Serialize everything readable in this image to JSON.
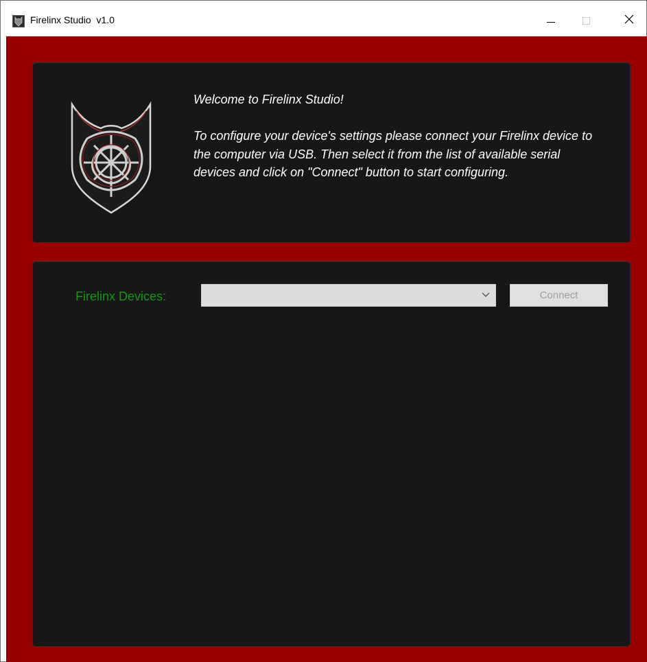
{
  "window": {
    "title": "Firelinx Studio  v1.0",
    "icon": "firelinx-app-icon",
    "controls": {
      "minimize": "minimize-icon",
      "maximize": "maximize-icon",
      "close": "close-icon"
    }
  },
  "colors": {
    "background": "#980000",
    "panel": "#171717",
    "label": "#109a10",
    "welcome_text": "#ffffff",
    "control_disabled": "#dddddd"
  },
  "welcome": {
    "logo": "celtic-knot-shield-logo",
    "title": "Welcome to Firelinx Studio!",
    "body": "To configure your device's settings please connect your Firelinx device to the computer via USB. Then select it from the list of available serial devices and click on \"Connect\" button to start configuring."
  },
  "devices": {
    "label": "Firelinx Devices:",
    "selected_value": "",
    "connect_label": "Connect"
  }
}
